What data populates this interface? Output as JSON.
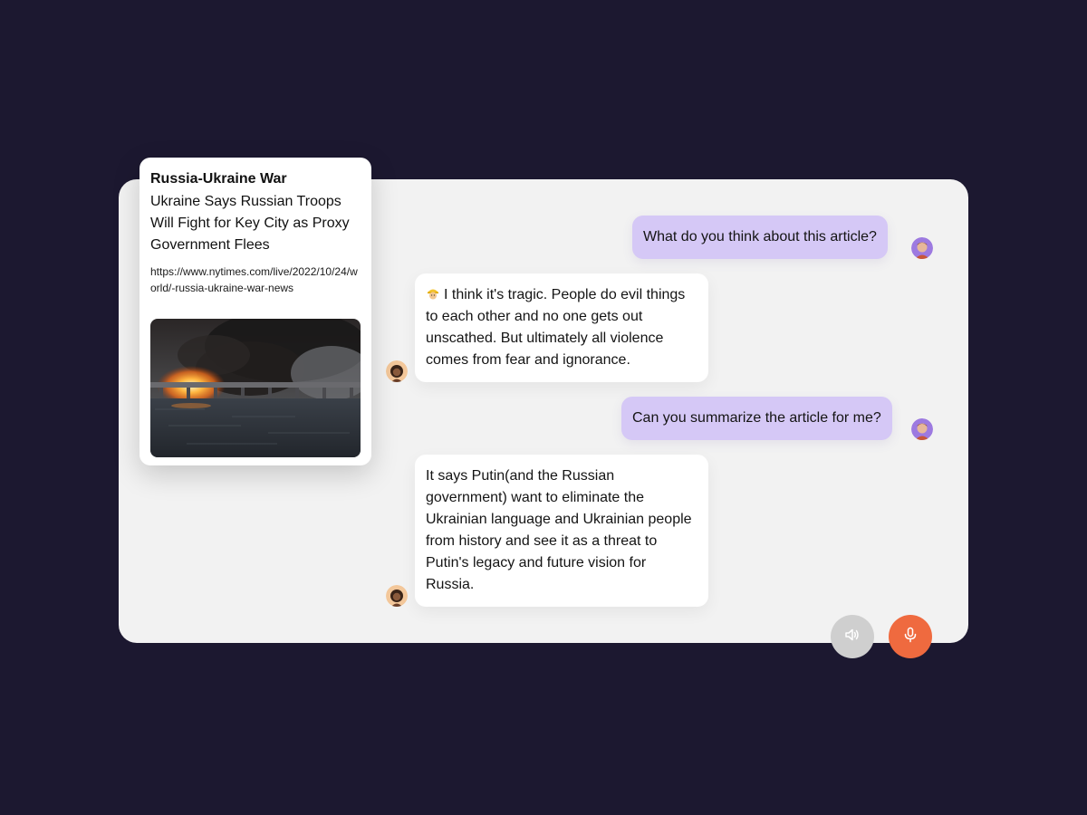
{
  "article": {
    "tag": "Russia-Ukraine War",
    "title": "Ukraine Says Russian Troops Will Fight for Key City as Proxy Government Flees",
    "url": "https://www.nytimes.com/live/2022/10/24/world/-russia-ukraine-war-news"
  },
  "messages": [
    {
      "role": "user",
      "text": "What do you think about this article?"
    },
    {
      "role": "assistant",
      "emoji": "construction-worker-emoji",
      "text": "I think it's tragic. People do evil things to each other and no one gets out unscathed. But ultimately all violence comes from fear and ignorance."
    },
    {
      "role": "user",
      "text": "Can you summarize the article for me?"
    },
    {
      "role": "assistant",
      "text": "It says Putin(and the Russian government) want to eliminate the Ukrainian language and Ukrainian people from history and see it as a threat to Putin's legacy and future vision for Russia."
    }
  ],
  "controls": {
    "speaker_icon": "speaker-icon",
    "mic_icon": "microphone-icon"
  },
  "colors": {
    "background": "#1c1830",
    "panel": "#f2f2f2",
    "user_bubble": "#d5c8f6",
    "bot_bubble": "#ffffff",
    "mic_button": "#ef6a3f",
    "speaker_button": "#cfcfcf"
  }
}
